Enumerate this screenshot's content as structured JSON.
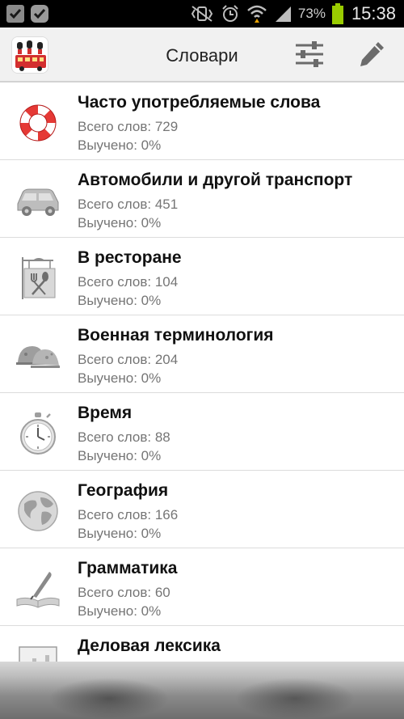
{
  "status_bar": {
    "battery_percent": "73%",
    "time": "15:38",
    "colors": {
      "background": "#000000",
      "battery": "#99cc00"
    },
    "left_icons": [
      "clipboard-check-icon",
      "check-circle-icon"
    ],
    "right_icons": [
      "vibrate-mute-icon",
      "alarm-clock-icon",
      "wifi-icon",
      "signal-icon",
      "battery-icon"
    ]
  },
  "action_bar": {
    "title": "Словари",
    "logo": "app-logo-london-bus-guards",
    "buttons": [
      "settings-sliders-icon",
      "pencil-icon"
    ]
  },
  "dictionaries": [
    {
      "title": "Часто употребляемые слова",
      "count": "Всего слов: 729",
      "learned": "Выучено: 0%",
      "icon": "lifebuoy-icon"
    },
    {
      "title": "Автомобили и другой транспорт",
      "count": "Всего слов: 451",
      "learned": "Выучено: 0%",
      "icon": "car-icon"
    },
    {
      "title": "В ресторане",
      "count": "Всего слов: 104",
      "learned": "Выучено: 0%",
      "icon": "restaurant-sign-icon"
    },
    {
      "title": "Военная терминология",
      "count": "Всего слов: 204",
      "learned": "Выучено: 0%",
      "icon": "military-helmets-icon"
    },
    {
      "title": "Время",
      "count": "Всего слов: 88",
      "learned": "Выучено: 0%",
      "icon": "stopwatch-icon"
    },
    {
      "title": "География",
      "count": "Всего слов: 166",
      "learned": "Выучено: 0%",
      "icon": "globe-icon"
    },
    {
      "title": "Грамматика",
      "count": "Всего слов: 60",
      "learned": "Выучено: 0%",
      "icon": "quill-book-icon"
    },
    {
      "title": "Деловая лексика",
      "count": "",
      "learned": "",
      "icon": "chart-board-icon"
    }
  ]
}
